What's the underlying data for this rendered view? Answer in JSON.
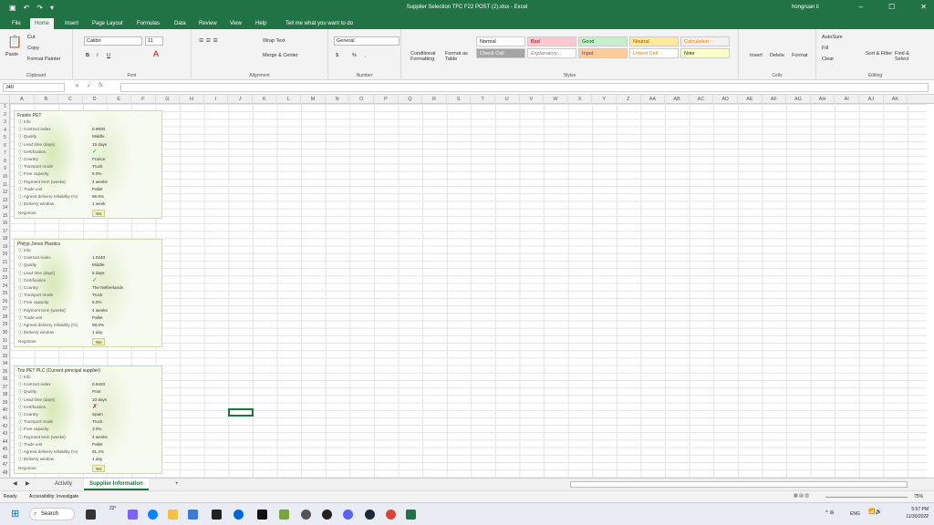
{
  "window": {
    "title": "Supplier Selection TFC F22 POST (2).xlsx  -  Excel",
    "user": "hongruan li"
  },
  "menu": {
    "tabs": [
      "File",
      "Home",
      "Insert",
      "Page Layout",
      "Formulas",
      "Data",
      "Review",
      "View",
      "Help"
    ],
    "active": "Home",
    "tell_me": "Tell me what you want to do"
  },
  "ribbon": {
    "clipboard": {
      "paste": "Paste",
      "cut": "Cut",
      "copy": "Copy",
      "format_painter": "Format Painter",
      "label": "Clipboard"
    },
    "font": {
      "name": "Calibri",
      "size": "11",
      "bold": "B",
      "italic": "I",
      "underline": "U",
      "label": "Font"
    },
    "alignment": {
      "wrap": "Wrap Text",
      "merge": "Merge & Center",
      "label": "Alignment"
    },
    "number": {
      "format": "General",
      "currency": "$",
      "percent": "%",
      "comma": ",",
      "label": "Number"
    },
    "styles": {
      "conditional": "Conditional Formatting",
      "format_table": "Format as Table",
      "normal": "Normal",
      "bad": "Bad",
      "good": "Good",
      "neutral": "Neutral",
      "calculation": "Calculation",
      "check_cell": "Check Cell",
      "explanatory": "Explanatory...",
      "input": "Input",
      "linked_cell": "Linked Cell",
      "note": "Note",
      "label": "Styles"
    },
    "cells": {
      "insert": "Insert",
      "delete": "Delete",
      "format": "Format",
      "label": "Cells"
    },
    "editing": {
      "autosum": "AutoSum",
      "fill": "Fill",
      "clear": "Clear",
      "sort": "Sort & Filter",
      "find": "Find & Select",
      "label": "Editing"
    }
  },
  "formula_bar": {
    "name_box": "J40",
    "fx": "fx",
    "value": ""
  },
  "columns": [
    "A",
    "B",
    "C",
    "D",
    "E",
    "F",
    "G",
    "H",
    "I",
    "J",
    "K",
    "L",
    "M",
    "N",
    "O",
    "P",
    "Q",
    "R",
    "S",
    "T",
    "U",
    "V",
    "W",
    "X",
    "Y",
    "Z",
    "AA",
    "AB",
    "AC",
    "AD",
    "AE",
    "AF",
    "AG",
    "AH",
    "AI",
    "AJ",
    "AK"
  ],
  "rows": [
    "1",
    "2",
    "3",
    "4",
    "5",
    "6",
    "7",
    "8",
    "9",
    "10",
    "11",
    "12",
    "13",
    "14",
    "15",
    "16",
    "17",
    "18",
    "19",
    "20",
    "21",
    "22",
    "23",
    "24",
    "25",
    "26",
    "27",
    "28",
    "29",
    "30",
    "31",
    "32",
    "33",
    "34",
    "35",
    "36",
    "37",
    "38",
    "39",
    "40",
    "41",
    "42",
    "43",
    "44",
    "45",
    "46",
    "47",
    "48"
  ],
  "suppliers": [
    {
      "name": "Franlin PET",
      "fields": [
        {
          "label": "Info",
          "value": ""
        },
        {
          "label": "Contract index",
          "value": "0.9800"
        },
        {
          "label": "Quality",
          "value": "Middle"
        },
        {
          "label": "Lead time (days)",
          "value": "15 days"
        },
        {
          "label": "Certification",
          "value": "✓",
          "mark": "check"
        },
        {
          "label": "Country",
          "value": "France"
        },
        {
          "label": "Transport mode",
          "value": "Truck"
        },
        {
          "label": "Free capacity",
          "value": "6.0%"
        },
        {
          "label": "Payment term (weeks)",
          "value": "4 weeks"
        },
        {
          "label": "Trade unit",
          "value": "Pallet"
        },
        {
          "label": "Agreed delivery reliability (%)",
          "value": "96.8%"
        },
        {
          "label": "Delivery window",
          "value": "1 week"
        }
      ],
      "negotiate": "Negotiate",
      "answer": "Yes"
    },
    {
      "name": "Philyp Jones Plastics",
      "fields": [
        {
          "label": "Info",
          "value": ""
        },
        {
          "label": "Contract index",
          "value": "1.0240"
        },
        {
          "label": "Quality",
          "value": "Middle"
        },
        {
          "label": "Lead time (days)",
          "value": "5 days"
        },
        {
          "label": "Certification",
          "value": "✓",
          "mark": "check"
        },
        {
          "label": "Country",
          "value": "The Netherlands"
        },
        {
          "label": "Transport mode",
          "value": "Truck"
        },
        {
          "label": "Free capacity",
          "value": "5.0%"
        },
        {
          "label": "Payment term (weeks)",
          "value": "4 weeks"
        },
        {
          "label": "Trade unit",
          "value": "Pallet"
        },
        {
          "label": "Agreed delivery reliability (%)",
          "value": "98.9%"
        },
        {
          "label": "Delivery window",
          "value": "1 day"
        }
      ],
      "negotiate": "Negotiate",
      "answer": "Yes"
    },
    {
      "name": "Trio PET PLC (Current principal supplier)",
      "fields": [
        {
          "label": "Info",
          "value": ""
        },
        {
          "label": "Contract index",
          "value": "0.9420"
        },
        {
          "label": "Quality",
          "value": "Poor"
        },
        {
          "label": "Lead time (days)",
          "value": "10 days"
        },
        {
          "label": "Certification",
          "value": "✗",
          "mark": "cross"
        },
        {
          "label": "Country",
          "value": "Spain"
        },
        {
          "label": "Transport mode",
          "value": "Truck"
        },
        {
          "label": "Free capacity",
          "value": "3.0%"
        },
        {
          "label": "Payment term (weeks)",
          "value": "4 weeks"
        },
        {
          "label": "Trade unit",
          "value": "Pallet"
        },
        {
          "label": "Agreed delivery reliability (%)",
          "value": "91.2%"
        },
        {
          "label": "Delivery window",
          "value": "1 day"
        }
      ],
      "negotiate": "Negotiate",
      "answer": "Yes"
    }
  ],
  "sheets": {
    "tabs": [
      "Activity",
      "Supplier Information"
    ],
    "active": "Supplier Information",
    "add": "+"
  },
  "status": {
    "ready": "Ready",
    "accessibility": "Accessibility: Investigate",
    "zoom": "75%"
  },
  "taskbar": {
    "search": "Search",
    "weather": "22°",
    "lang": "ENG",
    "time": "5:57 PM",
    "date": "11/30/2022"
  },
  "colors": {
    "accent": "#217346",
    "card_border": "#c8dcb0",
    "check": "#2ca02c",
    "cross": "#d62728"
  }
}
